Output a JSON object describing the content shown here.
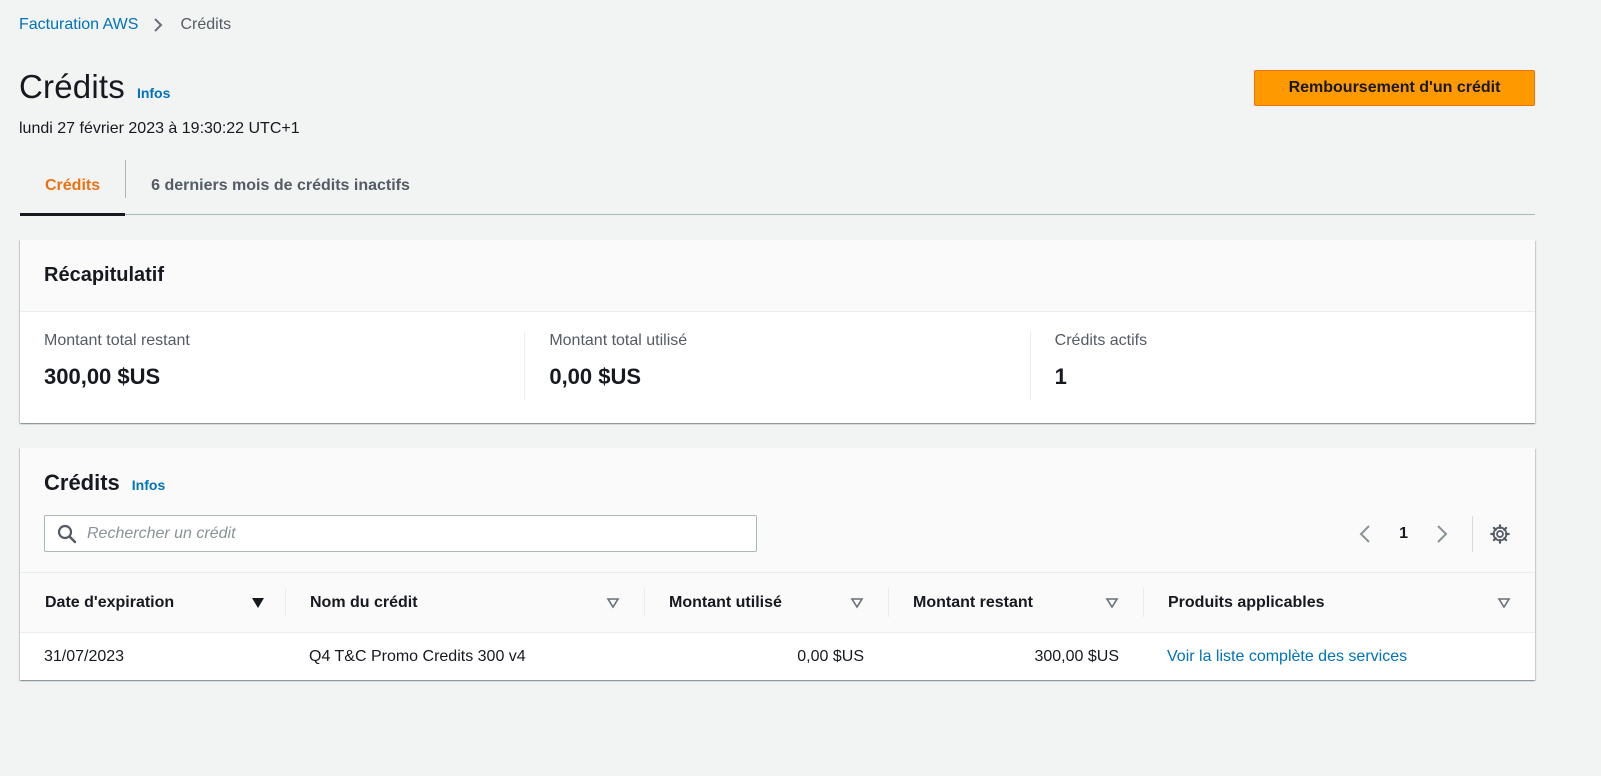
{
  "breadcrumb": {
    "root": "Facturation AWS",
    "current": "Crédits"
  },
  "header": {
    "title": "Crédits",
    "info_link": "Infos",
    "timestamp": "lundi 27 février 2023 à 19:30:22 UTC+1",
    "primary_action": "Remboursement d'un crédit"
  },
  "tabs": [
    {
      "label": "Crédits",
      "active": true
    },
    {
      "label": "6 derniers mois de crédits inactifs",
      "active": false
    }
  ],
  "summary": {
    "title": "Récapitulatif",
    "items": [
      {
        "label": "Montant total restant",
        "value": "300,00 $US"
      },
      {
        "label": "Montant total utilisé",
        "value": "0,00 $US"
      },
      {
        "label": "Crédits actifs",
        "value": "1"
      }
    ]
  },
  "credits": {
    "title": "Crédits",
    "info_link": "Infos",
    "search_placeholder": "Rechercher un crédit",
    "page": "1",
    "columns": [
      "Date d'expiration",
      "Nom du crédit",
      "Montant utilisé",
      "Montant restant",
      "Produits applicables"
    ],
    "rows": [
      {
        "expiration": "31/07/2023",
        "name": "Q4 T&C Promo Credits 300 v4",
        "used": "0,00 $US",
        "remaining": "300,00 $US",
        "products": "Voir la liste complète des services"
      }
    ]
  },
  "colors": {
    "accent": "#ff9900",
    "link": "#0073bb",
    "active_tab": "#ec7211"
  }
}
